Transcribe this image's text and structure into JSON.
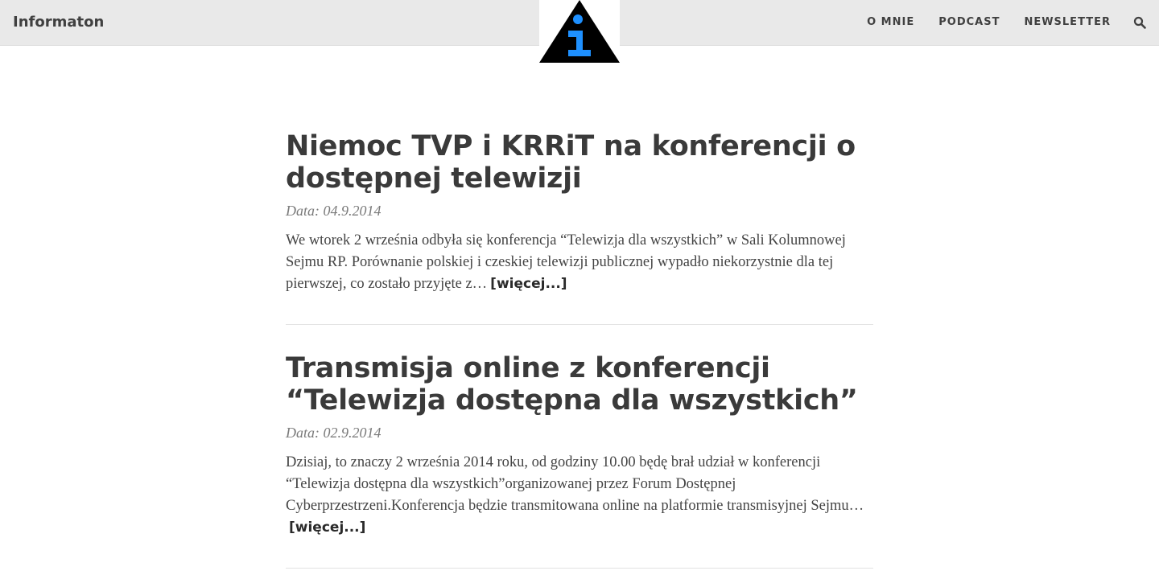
{
  "header": {
    "brand": "Informaton",
    "logo_icon": "info-triangle-icon",
    "logo_colors": {
      "triangle": "#000000",
      "letter": "#1e90ff"
    },
    "nav": [
      {
        "label": "O MNIE"
      },
      {
        "label": "PODCAST"
      },
      {
        "label": "NEWSLETTER"
      }
    ],
    "search_icon": "search-icon"
  },
  "posts": [
    {
      "title": "Niemoc TVP i KRRiT na konferencji o dostępnej telewizji",
      "date": "Data: 04.9.2014",
      "excerpt": "We wtorek 2 września odbyła się konferencja “Telewizja dla wszystkich” w Sali Kolumnowej Sejmu RP. Porównanie polskiej i czeskiej telewizji publicznej wypadło niekorzystnie dla tej pierwszej, co zostało przyjęte z…",
      "more": "[więcej...]"
    },
    {
      "title": "Transmisja online z konferencji “Telewizja dostępna dla wszystkich”",
      "date": "Data: 02.9.2014",
      "excerpt": "Dzisiaj, to znaczy 2 września 2014 roku, od godziny 10.00 będę brał udział w konferencji “Telewizja dostępna dla wszystkich”organizowanej przez Forum Dostępnej Cyberprzestrzeni.Konferencja będzie transmitowana online na platformie transmisyjnej Sejmu…",
      "more": "[więcej...]"
    }
  ]
}
